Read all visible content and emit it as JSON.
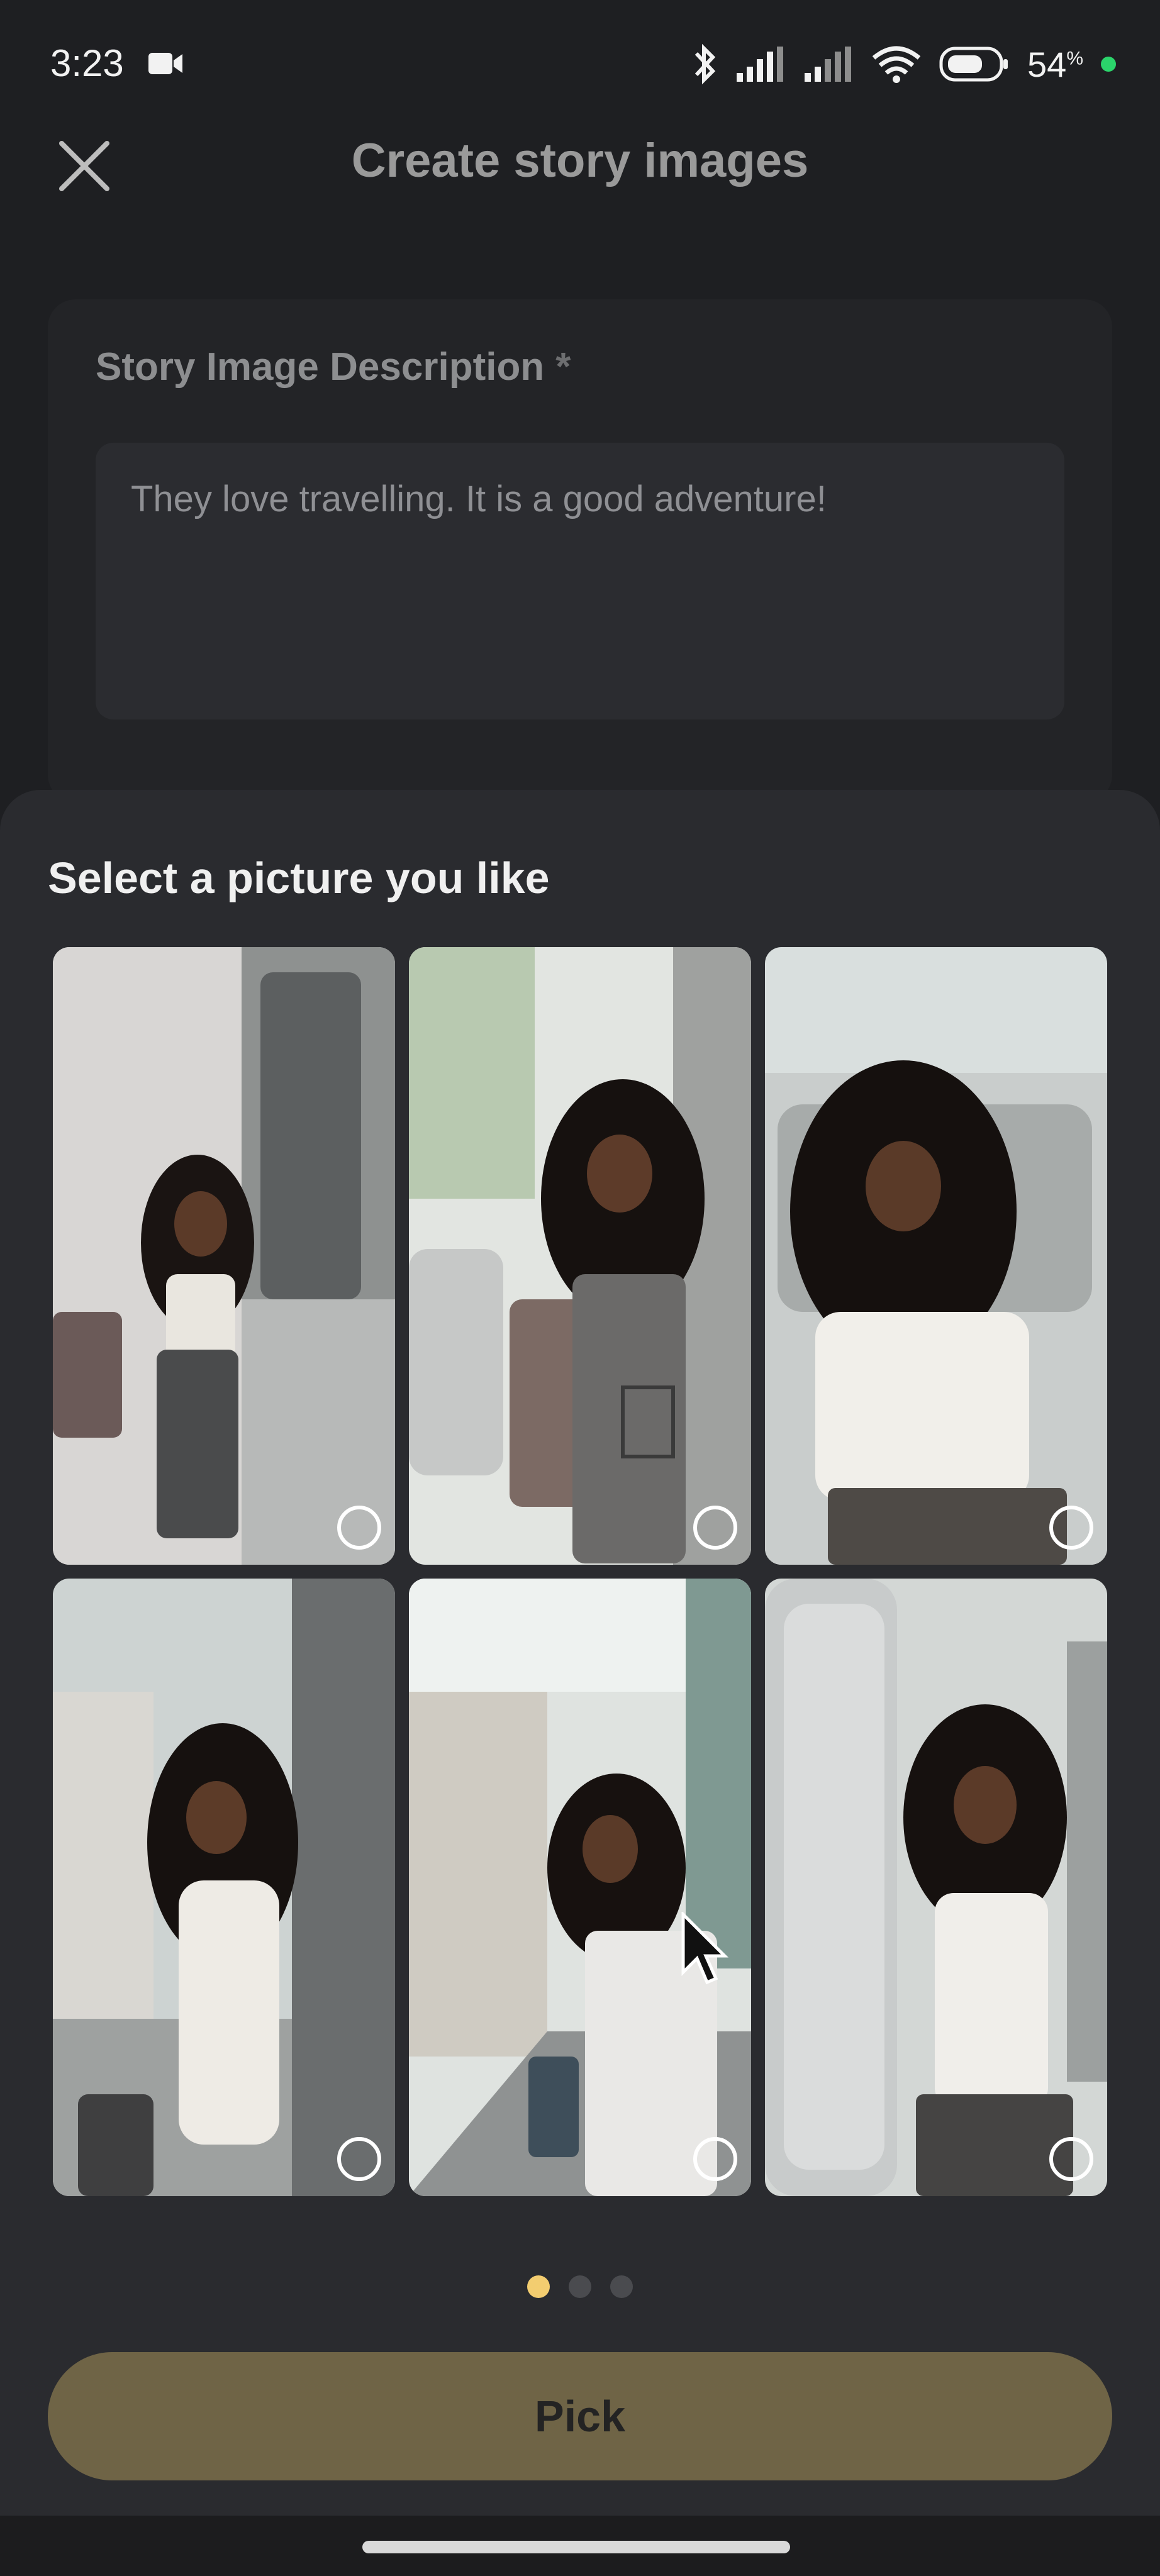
{
  "status_bar": {
    "time": "3:23",
    "battery_value": "54",
    "battery_unit": "%",
    "icons": [
      "video-camera-icon",
      "bluetooth-icon",
      "signal-icon",
      "signal-icon",
      "wifi-icon",
      "battery-icon"
    ],
    "colors": {
      "green_dot": "#2bd46b"
    }
  },
  "header": {
    "title": "Create story images",
    "close_icon": "close-icon"
  },
  "description": {
    "label": "Story Image Description",
    "required_mark": "*",
    "value": "They love travelling. It is a good adventure!"
  },
  "picker": {
    "title": "Select a picture you like",
    "images": [
      {
        "selected": false
      },
      {
        "selected": false
      },
      {
        "selected": false
      },
      {
        "selected": false
      },
      {
        "selected": false
      },
      {
        "selected": false
      }
    ],
    "pages": 3,
    "current_page": 1,
    "pick_label": "Pick"
  },
  "colors": {
    "accent": "#f3cd70",
    "button": "#6f6446",
    "sheet": "#2a2b2f",
    "background": "#1e1f22"
  }
}
